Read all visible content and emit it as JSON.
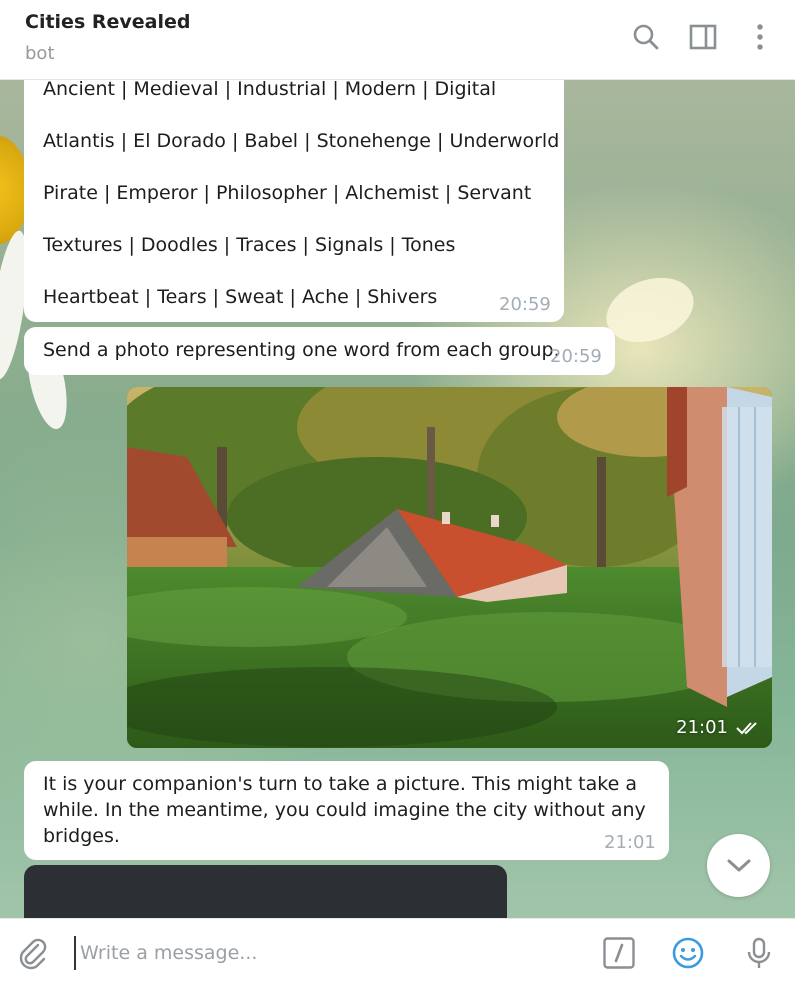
{
  "header": {
    "title": "Cities Revealed",
    "subtitle": "bot"
  },
  "messages": {
    "groups_bubble": {
      "lines": [
        "Ancient | Medieval | Industrial | Modern | Digital",
        "Atlantis | El Dorado | Babel | Stonehenge | Underworld",
        "Pirate | Emperor | Philosopher | Alchemist | Servant",
        "Textures | Doodles | Traces | Signals | Tones",
        "Heartbeat | Tears | Sweat | Ache | Shivers"
      ],
      "time": "20:59"
    },
    "instruction": {
      "text": "Send a photo representing one word from each group.",
      "time": "20:59"
    },
    "photo": {
      "time": "21:01",
      "status_icon": "double-check-icon"
    },
    "companion_turn": {
      "lines": [
        "It is your companion's turn to take a picture. This might take a",
        "while. In the meantime, you could imagine the city without any",
        "bridges."
      ],
      "time": "21:01"
    }
  },
  "composer": {
    "placeholder": "Write a message...",
    "attach_icon": "paperclip-icon",
    "commands_icon": "slash-command-icon",
    "emoji_icon": "smiley-icon",
    "voice_icon": "microphone-icon"
  },
  "colors": {
    "accent": "#3a9be0",
    "icon_gray": "#8a8f94",
    "timestamp": "#a3adb6"
  }
}
